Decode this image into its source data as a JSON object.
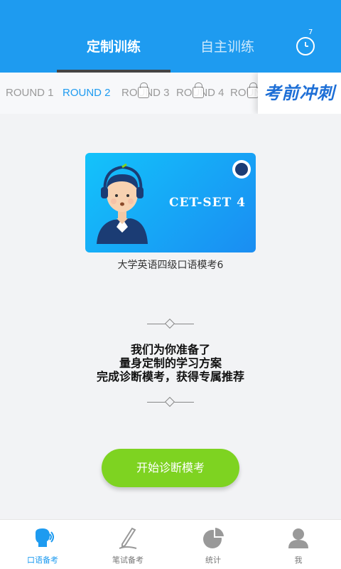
{
  "header": {
    "tabs": [
      {
        "label": "定制训练"
      },
      {
        "label": "自主训练"
      }
    ],
    "clock_badge": "7"
  },
  "rounds": {
    "items": [
      {
        "label": "ROUND 1",
        "locked": false
      },
      {
        "label": "ROUND 2",
        "locked": false,
        "active": true
      },
      {
        "label": "ROUND 3",
        "locked": true
      },
      {
        "label": "ROUND 4",
        "locked": true
      },
      {
        "label": "ROUND",
        "locked": true
      }
    ],
    "banner_text": "考前冲刺"
  },
  "card": {
    "title": "CET-SET 4",
    "caption": "大学英语四级口语模考6"
  },
  "message": {
    "line1": "我们为你准备了",
    "line2": "量身定制的学习方案",
    "line3": "完成诊断模考，获得专属推荐"
  },
  "start_button": {
    "label": "开始诊断模考"
  },
  "bottom_nav": {
    "items": [
      {
        "label": "口语备考",
        "icon": "speaking-icon",
        "active": true
      },
      {
        "label": "笔试备考",
        "icon": "pen-icon"
      },
      {
        "label": "统计",
        "icon": "pie-chart-icon"
      },
      {
        "label": "我",
        "icon": "user-icon"
      }
    ]
  },
  "colors": {
    "primary": "#1e9bf0",
    "accent_green": "#7ed321"
  }
}
